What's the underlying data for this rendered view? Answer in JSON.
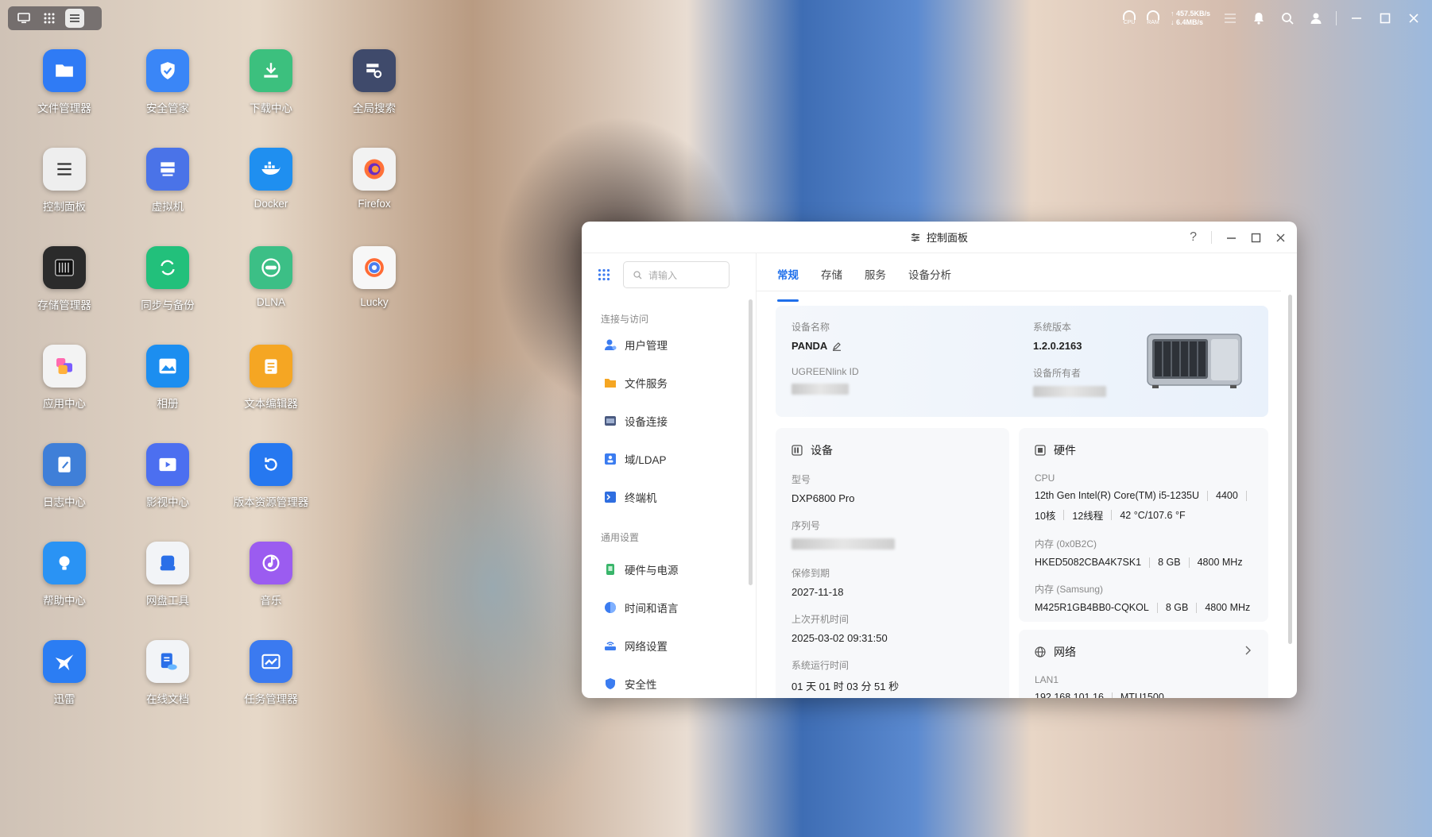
{
  "topbar": {
    "cpu_label": "CPU",
    "ram_label": "RAM",
    "upload_speed": "↑ 457.5KB/s",
    "download_speed": "↓ 6.4MB/s"
  },
  "desktop": {
    "apps": [
      {
        "label": "文件管理器",
        "icon": "folder-icon",
        "color": "#2f7bf5"
      },
      {
        "label": "安全管家",
        "icon": "shield-icon",
        "color": "#3a86f7"
      },
      {
        "label": "下载中心",
        "icon": "download-icon",
        "color": "#3cc07e"
      },
      {
        "label": "全局搜索",
        "icon": "search-server-icon",
        "color": "#3f4a6b"
      },
      {
        "label": "控制面板",
        "icon": "sliders-icon",
        "color": "#eeeeee"
      },
      {
        "label": "虚拟机",
        "icon": "server-icon",
        "color": "#4a73e8"
      },
      {
        "label": "Docker",
        "icon": "docker-icon",
        "color": "#1f8ff0"
      },
      {
        "label": "Firefox",
        "icon": "firefox-icon",
        "color": "#f2f2f2"
      },
      {
        "label": "存储管理器",
        "icon": "storage-icon",
        "color": "#2b2b2b"
      },
      {
        "label": "同步与备份",
        "icon": "sync-icon",
        "color": "#22c07b"
      },
      {
        "label": "DLNA",
        "icon": "dlna-icon",
        "color": "#3cbf86"
      },
      {
        "label": "Lucky",
        "icon": "lucky-icon",
        "color": "#f7f7f7"
      },
      {
        "label": "应用中心",
        "icon": "app-center-icon",
        "color": "#f3f3f3"
      },
      {
        "label": "相册",
        "icon": "photo-icon",
        "color": "#1c8ef0"
      },
      {
        "label": "文本编辑器",
        "icon": "notepad-icon",
        "color": "#f5a623"
      },
      {
        "label": "",
        "icon": "",
        "color": ""
      },
      {
        "label": "日志中心",
        "icon": "log-icon",
        "color": "#3f7fd8"
      },
      {
        "label": "影视中心",
        "icon": "video-icon",
        "color": "#4c6ff0"
      },
      {
        "label": "版本资源管理器",
        "icon": "version-icon",
        "color": "#2678f0"
      },
      {
        "label": "",
        "icon": "",
        "color": ""
      },
      {
        "label": "帮助中心",
        "icon": "help-bulb-icon",
        "color": "#2a93f4"
      },
      {
        "label": "网盘工具",
        "icon": "cloud-drive-icon",
        "color": "#f2f4f7"
      },
      {
        "label": "音乐",
        "icon": "music-icon",
        "color": "#9b5cf0"
      },
      {
        "label": "",
        "icon": "",
        "color": ""
      },
      {
        "label": "迅雷",
        "icon": "xunlei-icon",
        "color": "#2b7df3"
      },
      {
        "label": "在线文档",
        "icon": "online-doc-icon",
        "color": "#f2f4f7"
      },
      {
        "label": "任务管理器",
        "icon": "task-icon",
        "color": "#3b7af0"
      }
    ]
  },
  "window": {
    "title": "控制面板",
    "help": "?",
    "search_placeholder": "请输入",
    "sections": [
      {
        "title": "连接与访问",
        "items": [
          "用户管理",
          "文件服务",
          "设备连接",
          "域/LDAP",
          "终端机"
        ]
      },
      {
        "title": "通用设置",
        "items": [
          "硬件与电源",
          "时间和语言",
          "网络设置",
          "安全性"
        ]
      }
    ],
    "tabs": [
      "常规",
      "存储",
      "服务",
      "设备分析"
    ],
    "active_tab": "常规",
    "summary": {
      "device_name_label": "设备名称",
      "device_name": "PANDA",
      "ugreenlink_label": "UGREENlink ID",
      "system_version_label": "系统版本",
      "system_version": "1.2.0.2163",
      "owner_label": "设备所有者"
    },
    "device_card": {
      "title": "设备",
      "model_label": "型号",
      "model": "DXP6800 Pro",
      "serial_label": "序列号",
      "warranty_label": "保修到期",
      "warranty": "2027-11-18",
      "last_boot_label": "上次开机时间",
      "last_boot": "2025-03-02 09:31:50",
      "uptime_label": "系统运行时间",
      "uptime": "01 天 01 时 03 分 51 秒"
    },
    "hardware_card": {
      "title": "硬件",
      "cpu_label": "CPU",
      "cpu_model": "12th Gen Intel(R) Core(TM) i5-1235U",
      "cpu_freq": "4400",
      "cpu_cores": "10核",
      "cpu_threads": "12线程",
      "cpu_temp": "42 °C/107.6 °F",
      "mem1_label": "内存 (0x0B2C)",
      "mem1_model": "HKED5082CBA4K7SK1",
      "mem1_size": "8 GB",
      "mem1_speed": "4800 MHz",
      "mem2_label": "内存 (Samsung)",
      "mem2_model": "M425R1GB4BB0-CQKOL",
      "mem2_size": "8 GB",
      "mem2_speed": "4800 MHz"
    },
    "network_card": {
      "title": "网络",
      "lan_label": "LAN1",
      "lan_ip": "192.168.101.16",
      "mtu": "MTU1500"
    }
  }
}
